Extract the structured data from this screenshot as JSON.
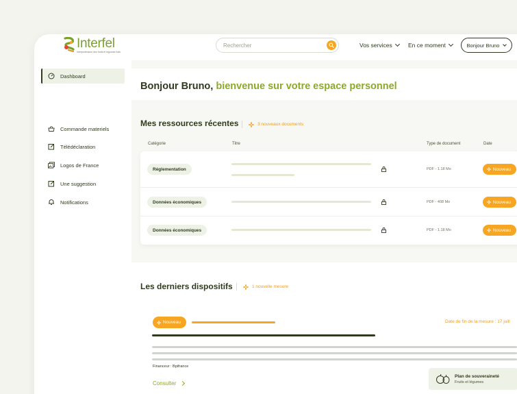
{
  "header": {
    "logo_text": "Interfel",
    "logo_tagline": "Interprofession des fruits et légumes frais",
    "search_placeholder": "Rechercher",
    "nav": [
      {
        "label": "Vos services"
      },
      {
        "label": "En ce moment"
      }
    ],
    "user_label": "Bonjour Bruno"
  },
  "sidebar": {
    "items": [
      {
        "label": "Dashboard",
        "icon": "dashboard-icon",
        "active": true
      },
      {
        "label": "Commande materiels",
        "icon": "basket-icon"
      },
      {
        "label": "Télédéclaration",
        "icon": "edit-icon"
      },
      {
        "label": "Logos de France",
        "icon": "images-icon"
      },
      {
        "label": "Une suggestion",
        "icon": "edit-icon"
      },
      {
        "label": "Notifications",
        "icon": "bell-icon"
      }
    ]
  },
  "welcome": {
    "greeting": "Bonjour Bruno,",
    "message": " bienvenue sur votre espace personnel"
  },
  "resources": {
    "title": "Mes ressources récentes",
    "badge": "3 nouveaux documents",
    "columns": [
      "Catégorie",
      "Titre",
      "Type de document",
      "Date"
    ],
    "rows": [
      {
        "category": "Réglementation",
        "doctype": "PDF - 1.18 Mo",
        "status": "Nouveau"
      },
      {
        "category": "Données économiques",
        "doctype": "PDF - 408 Mo",
        "status": "Nouveau"
      },
      {
        "category": "Données économiques",
        "doctype": "PDF - 1.18 Mo",
        "status": "Nouveau"
      }
    ]
  },
  "dispositifs": {
    "title": "Les derniers dispositifs",
    "badge": "1 nouvelle mesure",
    "card": {
      "status": "Nouveau",
      "date_fin": "Date de fin de la mesure : 17 juill",
      "financeur": "Financeur : Bpifrance",
      "cta": "Consulter",
      "tag_title": "Plan de souveraineté",
      "tag_subtitle": "Fruits et légumes"
    }
  },
  "colors": {
    "brand_green": "#8aaa28",
    "accent_orange": "#f6a623",
    "text_dark": "#2f3a1f"
  }
}
